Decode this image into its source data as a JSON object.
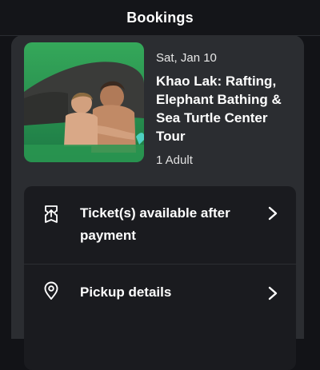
{
  "header": {
    "title": "Bookings"
  },
  "booking": {
    "date": "Sat, Jan 10",
    "title": "Khao Lak: Rafting, Elephant Bathing & Sea Turtle Center Tour",
    "travelers": "1 Adult"
  },
  "actions": [
    {
      "label": "Ticket(s) available after payment",
      "icon": "ticket-icon"
    },
    {
      "label": "Pickup details",
      "icon": "location-pin-icon"
    }
  ]
}
